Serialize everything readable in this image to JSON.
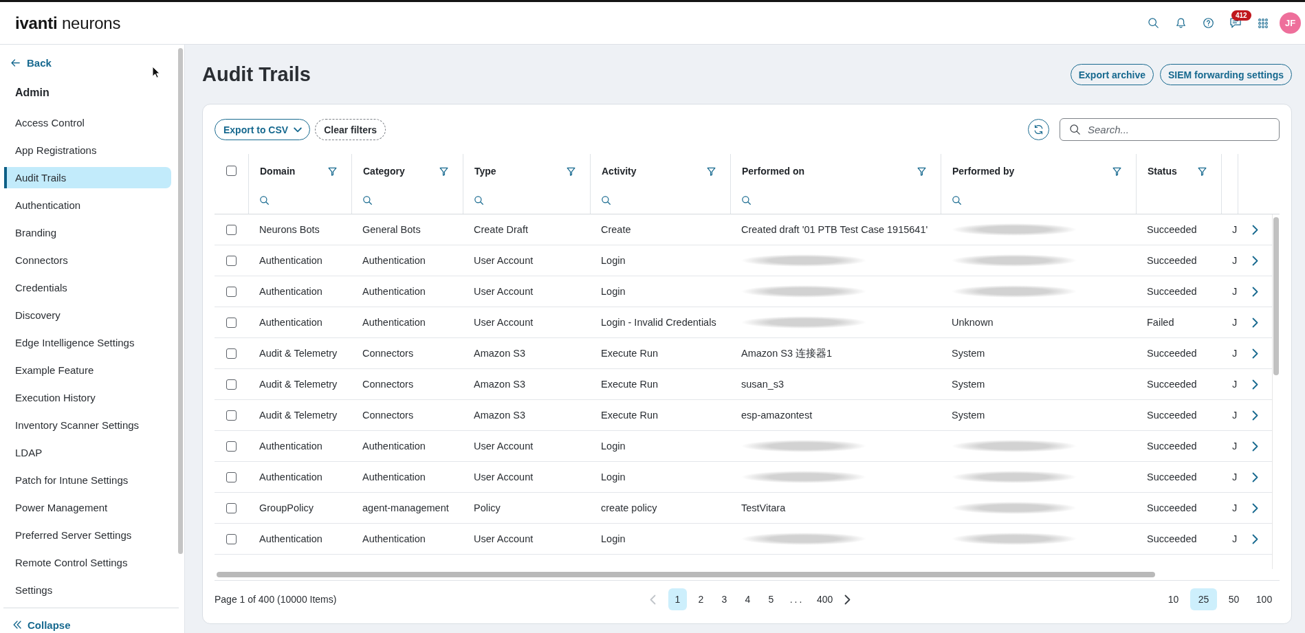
{
  "top_bar": {
    "logo": "**ivanti** neurons",
    "message_badge": "412",
    "avatar_initials": "JF"
  },
  "sidebar": {
    "back_label": "Back",
    "section_title": "Admin",
    "items": [
      {
        "label": "Access Control",
        "selected": false
      },
      {
        "label": "App Registrations",
        "selected": false
      },
      {
        "label": "Audit Trails",
        "selected": true
      },
      {
        "label": "Authentication",
        "selected": false
      },
      {
        "label": "Branding",
        "selected": false
      },
      {
        "label": "Connectors",
        "selected": false
      },
      {
        "label": "Credentials",
        "selected": false
      },
      {
        "label": "Discovery",
        "selected": false
      },
      {
        "label": "Edge Intelligence Settings",
        "selected": false
      },
      {
        "label": "Example Feature",
        "selected": false
      },
      {
        "label": "Execution History",
        "selected": false
      },
      {
        "label": "Inventory Scanner Settings",
        "selected": false
      },
      {
        "label": "LDAP",
        "selected": false
      },
      {
        "label": "Patch for Intune Settings",
        "selected": false
      },
      {
        "label": "Power Management",
        "selected": false
      },
      {
        "label": "Preferred Server Settings",
        "selected": false
      },
      {
        "label": "Remote Control Settings",
        "selected": false
      },
      {
        "label": "Settings",
        "selected": false
      }
    ],
    "collapse_label": "Collapse"
  },
  "page": {
    "title": "Audit Trails",
    "actions": [
      "Export archive",
      "SIEM forwarding settings"
    ]
  },
  "toolbar": {
    "export_label": "Export to CSV",
    "clear_filters_label": "Clear filters",
    "search": {
      "placeholder": "Search..."
    }
  },
  "table": {
    "all_checked": false,
    "columns": [
      {
        "label": "Domain",
        "filter": true,
        "search": true
      },
      {
        "label": "Category",
        "filter": true,
        "search": true
      },
      {
        "label": "Type",
        "filter": true,
        "search": true
      },
      {
        "label": "Activity",
        "filter": true,
        "search": true
      },
      {
        "label": "Performed on",
        "filter": true,
        "search": true
      },
      {
        "label": "Performed by",
        "filter": true,
        "search": true
      },
      {
        "label": "Status",
        "filter": true,
        "search": false
      }
    ],
    "rows": [
      {
        "checked": false,
        "domain": "Neurons Bots",
        "category": "General Bots",
        "type": "Create Draft",
        "activity": "Create",
        "performed_on": "Created draft '01 PTB Test Case 1915641'",
        "performed_by": {
          "blurred": true
        },
        "status": "Succeeded",
        "column_9": "J"
      },
      {
        "checked": false,
        "domain": "Authentication",
        "category": "Authentication",
        "type": "User Account",
        "activity": "Login",
        "performed_on": {
          "blurred": true
        },
        "performed_by": {
          "blurred": true
        },
        "status": "Succeeded",
        "column_9": "J"
      },
      {
        "checked": false,
        "domain": "Authentication",
        "category": "Authentication",
        "type": "User Account",
        "activity": "Login",
        "performed_on": {
          "blurred": true
        },
        "performed_by": {
          "blurred": true
        },
        "status": "Succeeded",
        "column_9": "J"
      },
      {
        "checked": false,
        "domain": "Authentication",
        "category": "Authentication",
        "type": "User Account",
        "activity": "Login - Invalid Credentials",
        "performed_on": {
          "blurred": true
        },
        "performed_by": "Unknown",
        "status": "Failed",
        "column_9": "J"
      },
      {
        "checked": false,
        "domain": "Audit & Telemetry",
        "category": "Connectors",
        "type": "Amazon S3",
        "activity": "Execute Run",
        "performed_on": "Amazon S3 连接器1",
        "performed_by": "System",
        "status": "Succeeded",
        "column_9": "J"
      },
      {
        "checked": false,
        "domain": "Audit & Telemetry",
        "category": "Connectors",
        "type": "Amazon S3",
        "activity": "Execute Run",
        "performed_on": "susan_s3",
        "performed_by": "System",
        "status": "Succeeded",
        "column_9": "J"
      },
      {
        "checked": false,
        "domain": "Audit & Telemetry",
        "category": "Connectors",
        "type": "Amazon S3",
        "activity": "Execute Run",
        "performed_on": "esp-amazontest",
        "performed_by": "System",
        "status": "Succeeded",
        "column_9": "J"
      },
      {
        "checked": false,
        "domain": "Authentication",
        "category": "Authentication",
        "type": "User Account",
        "activity": "Login",
        "performed_on": {
          "blurred": true
        },
        "performed_by": {
          "blurred": true
        },
        "status": "Succeeded",
        "column_9": "J"
      },
      {
        "checked": false,
        "domain": "Authentication",
        "category": "Authentication",
        "type": "User Account",
        "activity": "Login",
        "performed_on": {
          "blurred": true
        },
        "performed_by": {
          "blurred": true
        },
        "status": "Succeeded",
        "column_9": "J"
      },
      {
        "checked": false,
        "domain": "GroupPolicy",
        "category": "agent-management",
        "type": "Policy",
        "activity": "create policy",
        "performed_on": "TestVitara",
        "performed_by": {
          "blurred": true
        },
        "status": "Succeeded",
        "column_9": "J"
      },
      {
        "checked": false,
        "domain": "Authentication",
        "category": "Authentication",
        "type": "User Account",
        "activity": "Login",
        "performed_on": {
          "blurred": true
        },
        "performed_by": {
          "blurred": true
        },
        "status": "Succeeded",
        "column_9": "J"
      }
    ]
  },
  "pagination": {
    "summary": "Page 1 of 400 (10000 Items)",
    "previous_disabled": true,
    "next_disabled": false,
    "pages": [
      {
        "label": "1",
        "kind": "page",
        "selected": true
      },
      {
        "label": "2",
        "kind": "page",
        "selected": false
      },
      {
        "label": "3",
        "kind": "page",
        "selected": false
      },
      {
        "label": "4",
        "kind": "page",
        "selected": false
      },
      {
        "label": "5",
        "kind": "page",
        "selected": false
      },
      {
        "label": "...",
        "kind": "ellipsis",
        "selected": false
      },
      {
        "label": "400",
        "kind": "page",
        "selected": false
      }
    ],
    "page_sizes": [
      {
        "label": "10",
        "selected": false
      },
      {
        "label": "25",
        "selected": true
      },
      {
        "label": "50",
        "selected": false
      },
      {
        "label": "100",
        "selected": false
      }
    ]
  }
}
